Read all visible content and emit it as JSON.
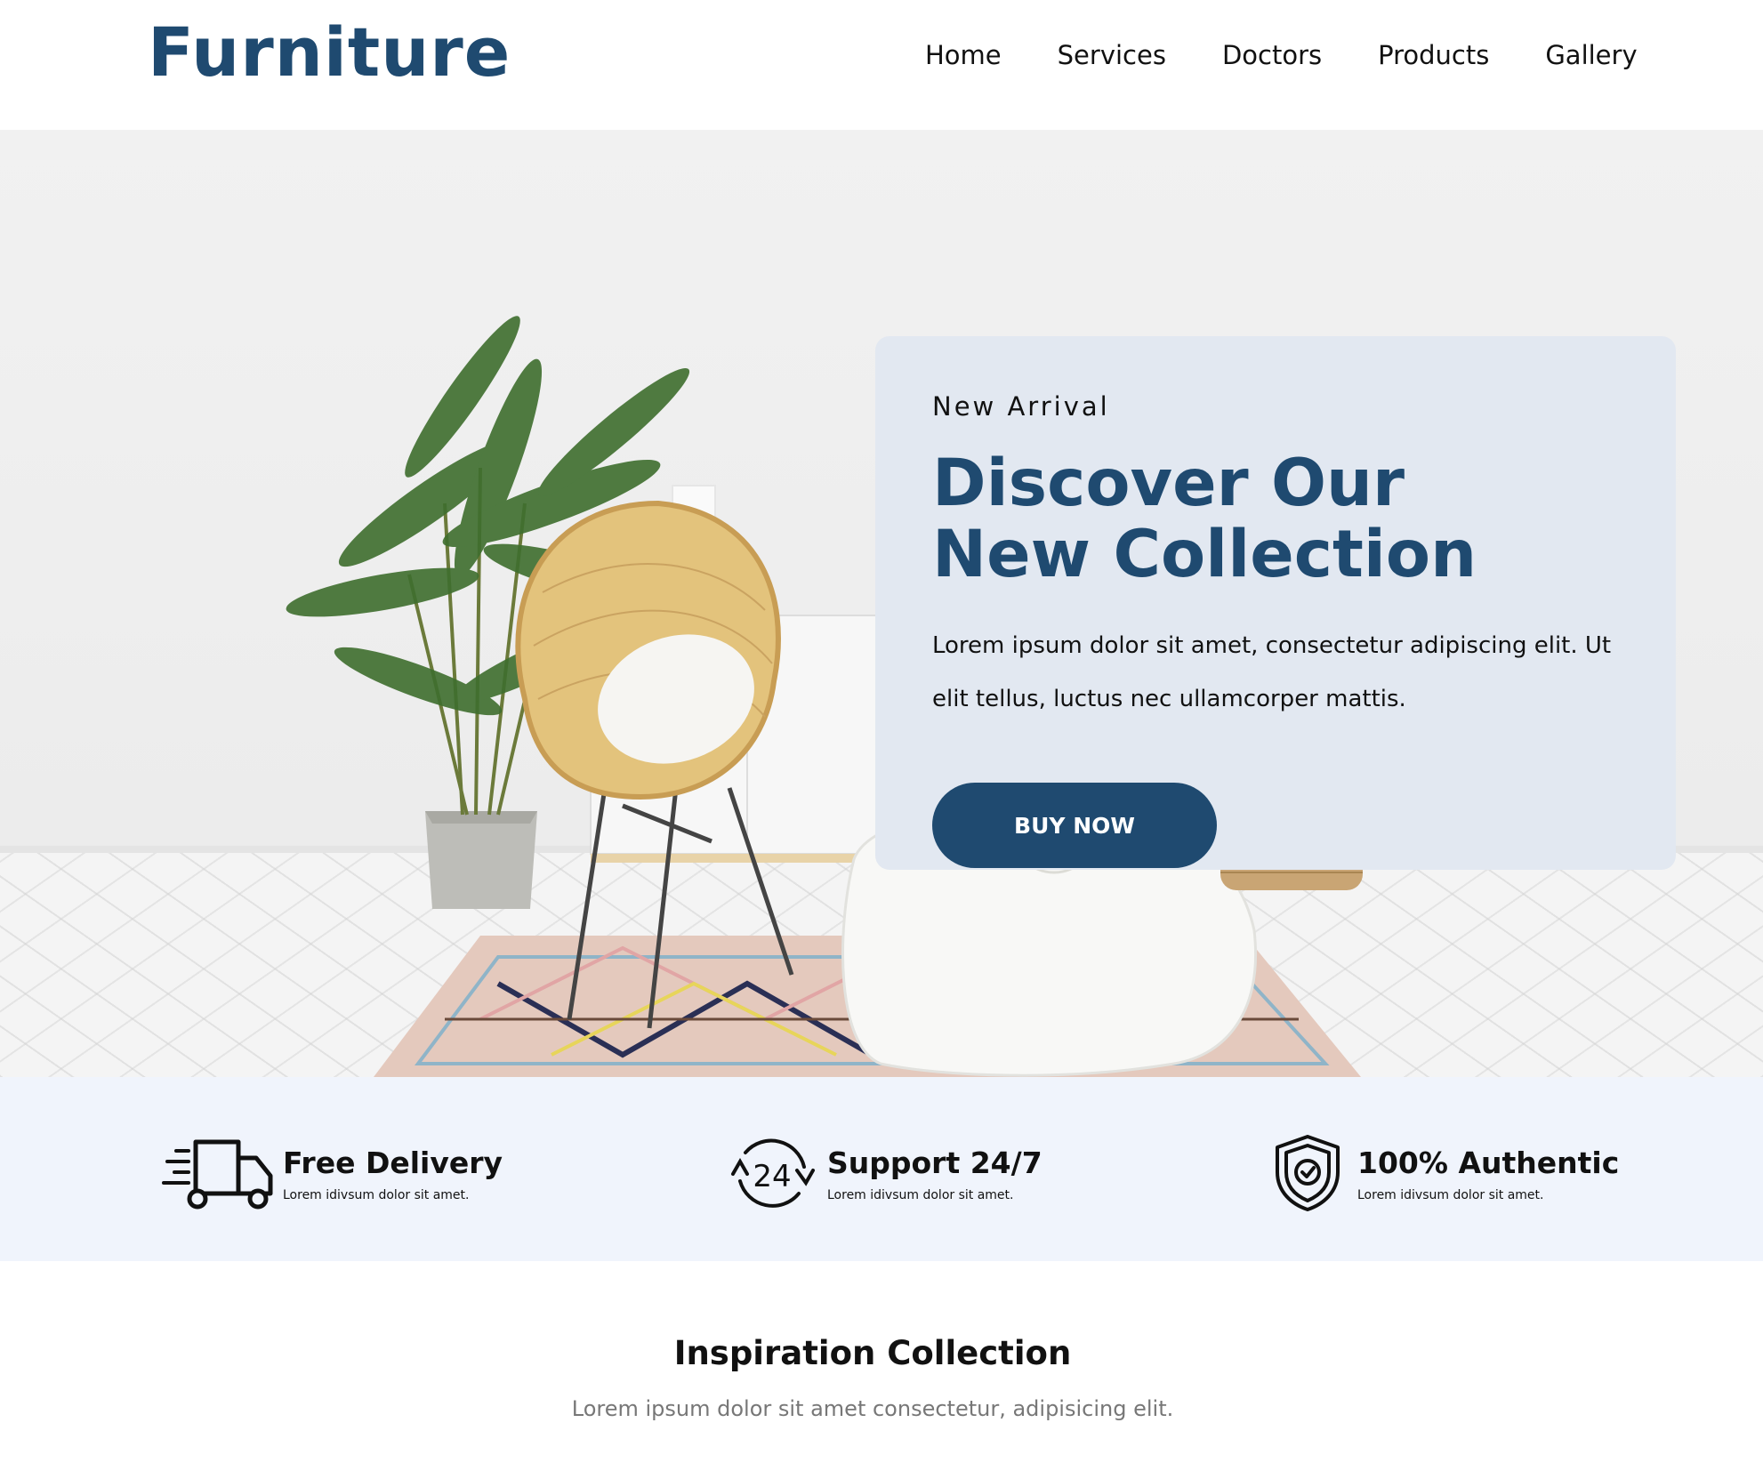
{
  "brand": {
    "name": "Furniture",
    "color": "#1f4a70"
  },
  "nav": {
    "items": [
      "Home",
      "Services",
      "Doctors",
      "Products",
      "Gallery"
    ]
  },
  "hero": {
    "eyebrow": "New Arrival",
    "headline_line1": "Discover Our",
    "headline_line2": "New Collection",
    "body": "Lorem ipsum dolor sit amet, consectetur adipiscing elit. Ut elit tellus, luctus nec ullamcorper mattis.",
    "cta_label": "BUY NOW",
    "card_color": "#e2e8f1"
  },
  "features": [
    {
      "icon": "delivery-truck-icon",
      "title": "Free Delivery",
      "desc": "Lorem idivsum dolor sit amet."
    },
    {
      "icon": "support-24-icon",
      "title": "Support 24/7",
      "desc": "Lorem idivsum dolor sit amet."
    },
    {
      "icon": "shield-check-icon",
      "title": "100% Authentic",
      "desc": "Lorem idivsum dolor sit amet."
    }
  ],
  "inspiration": {
    "title": "Inspiration Collection",
    "subtitle": "Lorem ipsum dolor sit amet consectetur, adipisicing elit."
  }
}
